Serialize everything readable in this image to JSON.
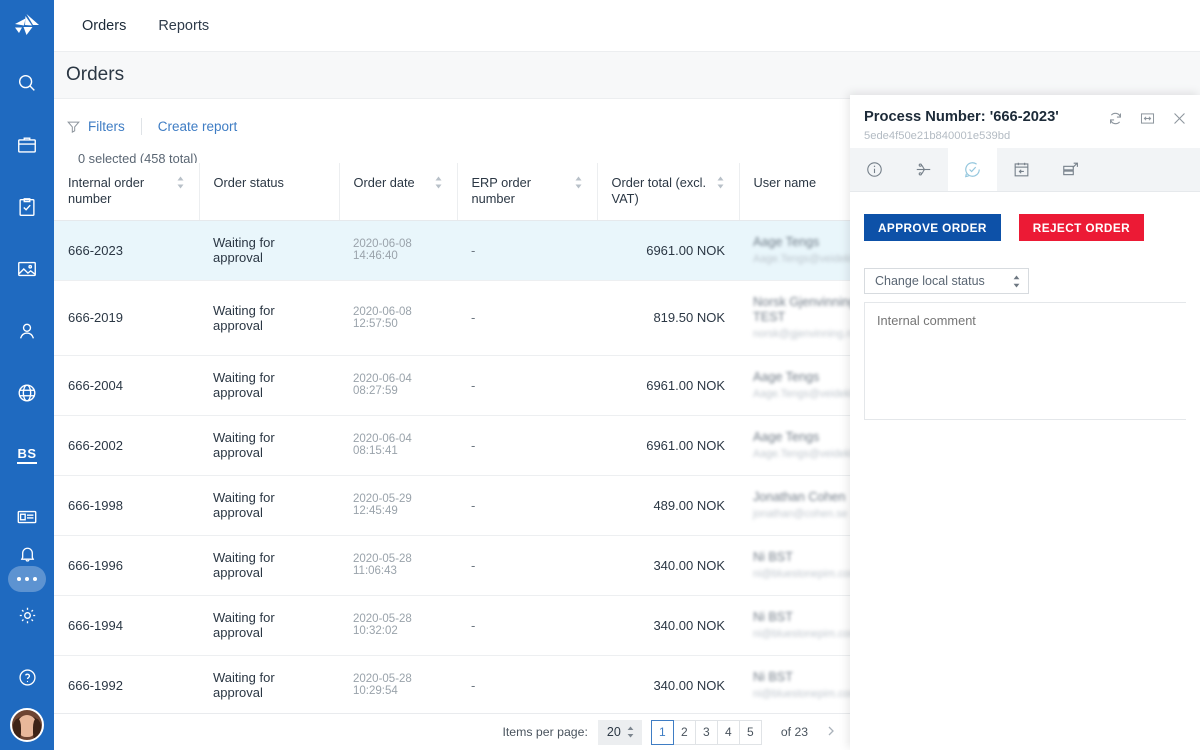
{
  "brand": {
    "logo_icon": "origami-bird-logo",
    "sidebar_color": "#1f6ac0"
  },
  "sidebar": {
    "items": [
      {
        "icon": "search-icon",
        "name": "search"
      },
      {
        "icon": "briefcase-icon",
        "name": "products"
      },
      {
        "icon": "clipboard-check-icon",
        "name": "tasks"
      },
      {
        "icon": "image-icon",
        "name": "media"
      },
      {
        "icon": "user-icon",
        "name": "users"
      },
      {
        "icon": "globe-icon",
        "name": "globalization"
      },
      {
        "icon": "bs-text-icon",
        "label": "BS",
        "name": "bs"
      },
      {
        "icon": "id-card-icon",
        "name": "suppliers"
      },
      {
        "icon": "ellipsis-icon",
        "name": "more",
        "active": true
      }
    ],
    "bottom_items": [
      {
        "icon": "bell-icon",
        "name": "notifications"
      },
      {
        "icon": "gear-icon",
        "name": "settings"
      },
      {
        "icon": "help-circle-icon",
        "name": "help"
      },
      {
        "icon": "avatar",
        "name": "user-profile"
      }
    ]
  },
  "topnav": {
    "items": [
      {
        "label": "Orders",
        "active": true
      },
      {
        "label": "Reports",
        "active": false
      }
    ]
  },
  "page": {
    "title": "Orders"
  },
  "toolbar": {
    "filters_label": "Filters",
    "filters_icon": "funnel-icon",
    "create_report_label": "Create report",
    "selection_info": "0 selected (458 total)"
  },
  "table": {
    "columns": [
      {
        "label": "Internal order number",
        "sortable": true,
        "align": "left"
      },
      {
        "label": "Order status",
        "sortable": false,
        "align": "left"
      },
      {
        "label": "Order date",
        "sortable": true,
        "align": "left"
      },
      {
        "label": "ERP order number",
        "sortable": true,
        "align": "left"
      },
      {
        "label": "Order total (excl. VAT)",
        "sortable": true,
        "align": "right"
      },
      {
        "label": "User name",
        "sortable": true,
        "align": "left"
      }
    ],
    "rows": [
      {
        "internal_order_number": "666-2023",
        "order_status": "Waiting for approval",
        "order_date": "2020-06-08 14:46:40",
        "erp_order_number": "-",
        "order_total": "6961.00 NOK",
        "user_name": "Aage Tengs",
        "user_email": "Aage.Tengs@veidekke.no",
        "selected": true
      },
      {
        "internal_order_number": "666-2019",
        "order_status": "Waiting for approval",
        "order_date": "2020-06-08 12:57:50",
        "erp_order_number": "-",
        "order_total": "819.50 NOK",
        "user_name": "Norsk Gjenvinning AS TEST",
        "user_email": "norsk@gjenvinning.no",
        "selected": false
      },
      {
        "internal_order_number": "666-2004",
        "order_status": "Waiting for approval",
        "order_date": "2020-06-04 08:27:59",
        "erp_order_number": "-",
        "order_total": "6961.00 NOK",
        "user_name": "Aage Tengs",
        "user_email": "Aage.Tengs@veidekke.no",
        "selected": false
      },
      {
        "internal_order_number": "666-2002",
        "order_status": "Waiting for approval",
        "order_date": "2020-06-04 08:15:41",
        "erp_order_number": "-",
        "order_total": "6961.00 NOK",
        "user_name": "Aage Tengs",
        "user_email": "Aage.Tengs@veidekke.no",
        "selected": false
      },
      {
        "internal_order_number": "666-1998",
        "order_status": "Waiting for approval",
        "order_date": "2020-05-29 12:45:49",
        "erp_order_number": "-",
        "order_total": "489.00 NOK",
        "user_name": "Jonathan Cohen",
        "user_email": "jonathan@cohen.se",
        "selected": false
      },
      {
        "internal_order_number": "666-1996",
        "order_status": "Waiting for approval",
        "order_date": "2020-05-28 11:06:43",
        "erp_order_number": "-",
        "order_total": "340.00 NOK",
        "user_name": "Ni BST",
        "user_email": "ni@bluestonepim.com",
        "selected": false
      },
      {
        "internal_order_number": "666-1994",
        "order_status": "Waiting for approval",
        "order_date": "2020-05-28 10:32:02",
        "erp_order_number": "-",
        "order_total": "340.00 NOK",
        "user_name": "Ni BST",
        "user_email": "ni@bluestonepim.com",
        "selected": false
      },
      {
        "internal_order_number": "666-1992",
        "order_status": "Waiting for approval",
        "order_date": "2020-05-28 10:29:54",
        "erp_order_number": "-",
        "order_total": "340.00 NOK",
        "user_name": "Ni BST",
        "user_email": "ni@bluestonepim.com",
        "selected": false
      }
    ]
  },
  "pagination": {
    "items_per_page_label": "Items per page:",
    "items_per_page_value": "20",
    "pages": [
      "1",
      "2",
      "3",
      "4",
      "5"
    ],
    "current_page": "1",
    "of_label": "of 23",
    "next_icon": "chevron-right-icon"
  },
  "panel": {
    "title": "Process Number: '666-2023'",
    "subtitle": "5ede4f50e21b840001e539bd",
    "actions": [
      {
        "icon": "refresh-icon",
        "name": "refresh"
      },
      {
        "icon": "expand-horizontal-icon",
        "name": "expand"
      },
      {
        "icon": "close-icon",
        "name": "close"
      }
    ],
    "tabs": [
      {
        "icon": "info-circle-icon",
        "name": "details",
        "active": false
      },
      {
        "icon": "workflow-icon",
        "name": "workflow",
        "active": false
      },
      {
        "icon": "check-circle-icon",
        "name": "approval",
        "active": true
      },
      {
        "icon": "calendar-back-icon",
        "name": "history",
        "active": false
      },
      {
        "icon": "export-icon",
        "name": "export",
        "active": false
      }
    ],
    "approve_label": "APPROVE ORDER",
    "reject_label": "REJECT ORDER",
    "approve_color": "#0d51a8",
    "reject_color": "#ec1a35",
    "status_select_value": "Change local status",
    "comment_placeholder": "Internal comment",
    "comment_value": ""
  }
}
